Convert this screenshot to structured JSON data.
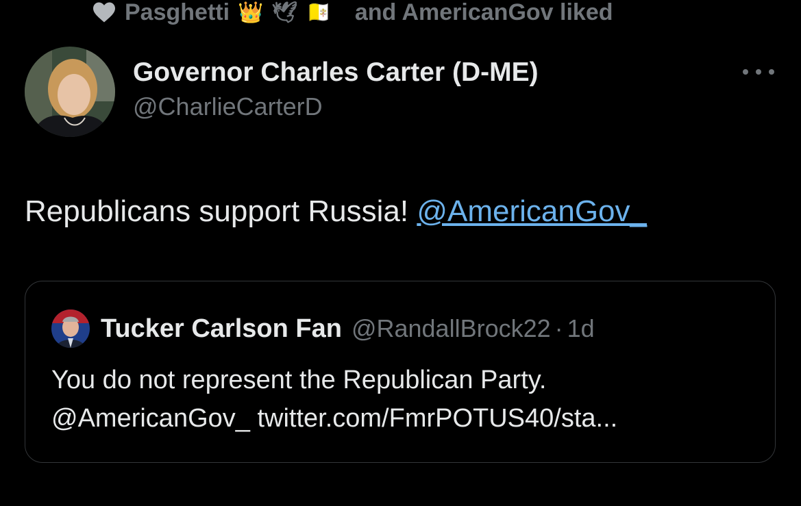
{
  "social_context": {
    "user": "Pasghetti",
    "emojis": [
      "👑",
      "🕊",
      "🇻🇦"
    ],
    "suffix": "and AmericanGov liked",
    "icon": "heart-icon"
  },
  "tweet": {
    "author_name": "Governor Charles Carter (D-ME)",
    "author_handle": "@CharlieCarterD",
    "text": "Republicans support Russia! ",
    "mention": "@AmericanGov_",
    "more_icon": "more-options-icon"
  },
  "quoted_tweet": {
    "author_name": "Tucker Carlson Fan",
    "author_handle": "@RandallBrock22",
    "separator": "·",
    "time": "1d",
    "line1": "You do not represent the Republican Party.",
    "line2": "@AmericanGov_ twitter.com/FmrPOTUS40/sta..."
  },
  "colors": {
    "background": "#000000",
    "text_primary": "#e7e9ea",
    "text_secondary": "#71767b",
    "link": "#6cb2ec",
    "border": "#333639"
  }
}
